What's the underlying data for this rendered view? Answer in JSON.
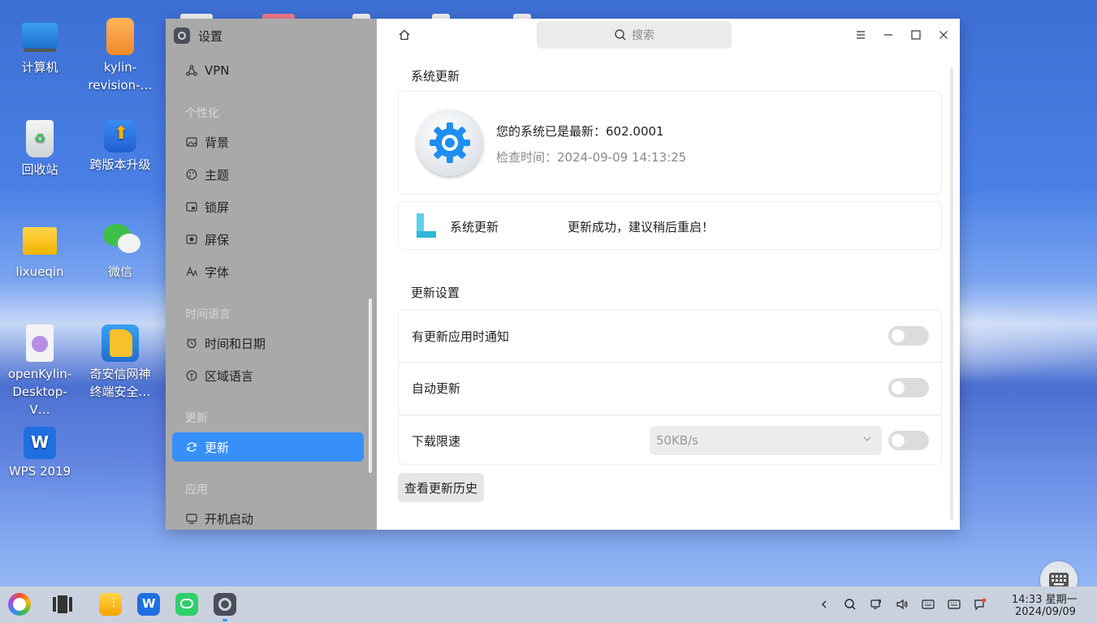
{
  "desktop": {
    "icons": [
      {
        "label": "计算机"
      },
      {
        "label": "kylin-\nrevision-…"
      },
      {
        "label": "回收站"
      },
      {
        "label": "跨版本升级"
      },
      {
        "label": "lixueqin"
      },
      {
        "label": "微信"
      },
      {
        "label": "openKylin-\nDesktop-V…"
      },
      {
        "label": "奇安信网神\n终端安全…"
      },
      {
        "label": "WPS 2019"
      }
    ]
  },
  "window": {
    "app_title": "设置",
    "search_placeholder": "搜索",
    "sidebar": {
      "vpn": "VPN",
      "cat_personal": "个性化",
      "background": "背景",
      "theme": "主题",
      "lockscreen": "锁屏",
      "screensaver": "屏保",
      "font": "字体",
      "cat_time": "时间语言",
      "datetime": "时间和日期",
      "region": "区域语言",
      "cat_update": "更新",
      "update": "更新",
      "cat_apps": "应用",
      "autostart": "开机启动"
    },
    "main": {
      "system_update_title": "系统更新",
      "status_line": "您的系统已是最新：602.0001",
      "check_time": "检查时间：2024-09-09 14:13:25",
      "update_item_name": "系统更新",
      "update_item_status": "更新成功，建议稍后重启！",
      "settings_title": "更新设置",
      "notify_label": "有更新应用时通知",
      "auto_update_label": "自动更新",
      "speed_limit_label": "下载限速",
      "speed_value": "50KB/s",
      "history_button": "查看更新历史",
      "toggles": {
        "notify": false,
        "auto_update": false,
        "speed_limit": false
      }
    }
  },
  "taskbar": {
    "time": "14:33 星期一",
    "date": "2024/09/09"
  },
  "colors": {
    "accent": "#3790fa",
    "sidebar_bg": "#a9a9a9"
  }
}
